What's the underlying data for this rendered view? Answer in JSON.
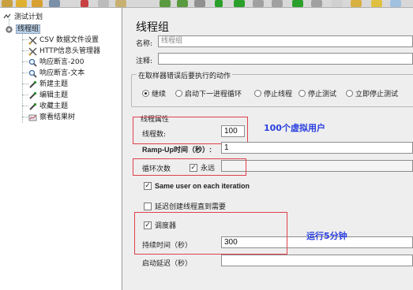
{
  "tree": {
    "items": [
      {
        "label": "测试计划",
        "icon": "test-plan-icon"
      },
      {
        "label": "线程组",
        "icon": "gear-icon"
      },
      {
        "label": "CSV 数据文件设置",
        "icon": "scissors-icon"
      },
      {
        "label": "HTTP信息头管理器",
        "icon": "scissors-icon"
      },
      {
        "label": "响应断言-200",
        "icon": "magnifier-icon"
      },
      {
        "label": "响应断言-文本",
        "icon": "magnifier-icon"
      },
      {
        "label": "新建主题",
        "icon": "pipette-icon"
      },
      {
        "label": "编辑主题",
        "icon": "pipette-icon"
      },
      {
        "label": "收藏主题",
        "icon": "pipette-icon"
      },
      {
        "label": "察看结果树",
        "icon": "chart-icon"
      }
    ]
  },
  "panel": {
    "title": "线程组",
    "name_label": "名称:",
    "name_value": "线程组",
    "comment_label": "注释:",
    "comment_value": "",
    "error_group_title": "在取样器错误后要执行的动作",
    "error_options": [
      {
        "label": "继续",
        "selected": true
      },
      {
        "label": "启动下一进程循环",
        "selected": false
      },
      {
        "label": "停止线程",
        "selected": false
      },
      {
        "label": "停止测试",
        "selected": false
      },
      {
        "label": "立即停止测试",
        "selected": false
      }
    ],
    "thread_props_title": "线程属性",
    "threads_label": "线程数:",
    "threads_value": "100",
    "rampup_label": "Ramp-Up时间（秒）:",
    "rampup_value": "1",
    "loop_label": "循环次数",
    "forever_label": "永远",
    "forever_checked": true,
    "same_user_label": "Same user on each iteration",
    "same_user_checked": true,
    "delay_label": "延迟创建线程直到需要",
    "delay_checked": false,
    "scheduler_label": "调度器",
    "scheduler_checked": true,
    "duration_label": "持续时间（秒）",
    "duration_value": "300",
    "startup_delay_label": "启动延迟（秒）",
    "startup_delay_value": ""
  },
  "annotations": {
    "users": "100个虚拟用户",
    "duration": "运行5分钟"
  },
  "colors": {
    "annotation": "#2a3fe0",
    "highlight_box": "#e0404a"
  }
}
